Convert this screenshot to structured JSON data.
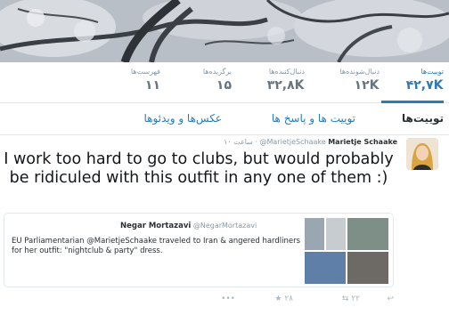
{
  "profile": {
    "stats": [
      {
        "label": "توییت‌ها",
        "value": "۴۲,۷K",
        "active": true
      },
      {
        "label": "دنبال‌شونده‌ها",
        "value": "۱۲K",
        "active": false
      },
      {
        "label": "دنبال‌کننده‌ها",
        "value": "۳۲,۸K",
        "active": false
      },
      {
        "label": "برگزیده‌ها",
        "value": "۱۵",
        "active": false
      },
      {
        "label": "فهرست‌ها",
        "value": "۱۱",
        "active": false
      }
    ]
  },
  "tabs": [
    {
      "label": "توییت‌ها",
      "active": true
    },
    {
      "label": "توییت ها و پاسخ ها",
      "active": false
    },
    {
      "label": "عکس‌ها و ویدئوها",
      "active": false
    }
  ],
  "tweet": {
    "name": "Marietje Schaake",
    "handle": "@MarietjeSchaake",
    "time": "۱۰ ساعت",
    "text": "I work too hard to go to clubs, but would probably be ridiculed with this outfit in any one of them :)",
    "quote": {
      "name": "Negar Mortazavi",
      "handle": "@NegarMortazavi",
      "text": "EU Parliamentarian @MarietjeSchaake traveled to Iran & angered hardliners for her outfit: \"nightclub & party\" dress."
    },
    "actions": {
      "reply_icon": "reply-icon",
      "retweet_icon": "retweet-icon",
      "retweet_count": "۲۲",
      "like_icon": "star-icon",
      "like_count": "۲۸",
      "more_icon": "more-icon"
    }
  },
  "colors": {
    "accent": "#2b7bb9",
    "muted": "#8899a6",
    "border": "#e1e8ed"
  }
}
